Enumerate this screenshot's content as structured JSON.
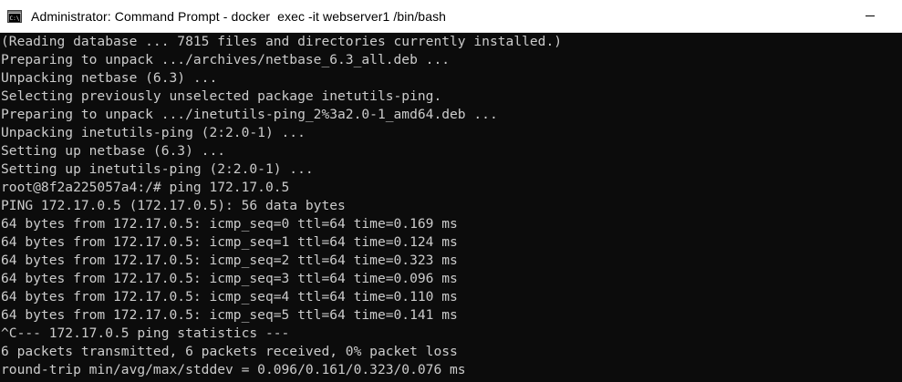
{
  "window": {
    "title": "Administrator: Command Prompt - docker  exec -it webserver1 /bin/bash",
    "icon": "command-prompt-icon",
    "minimize_icon": "minimize-icon"
  },
  "colors": {
    "titlebar_bg": "#ffffff",
    "terminal_bg": "#0c0c0c",
    "terminal_fg": "#cccccc"
  },
  "terminal": {
    "lines": [
      "(Reading database ... 7815 files and directories currently installed.)",
      "Preparing to unpack .../archives/netbase_6.3_all.deb ...",
      "Unpacking netbase (6.3) ...",
      "Selecting previously unselected package inetutils-ping.",
      "Preparing to unpack .../inetutils-ping_2%3a2.0-1_amd64.deb ...",
      "Unpacking inetutils-ping (2:2.0-1) ...",
      "Setting up netbase (6.3) ...",
      "Setting up inetutils-ping (2:2.0-1) ...",
      "root@8f2a225057a4:/# ping 172.17.0.5",
      "PING 172.17.0.5 (172.17.0.5): 56 data bytes",
      "64 bytes from 172.17.0.5: icmp_seq=0 ttl=64 time=0.169 ms",
      "64 bytes from 172.17.0.5: icmp_seq=1 ttl=64 time=0.124 ms",
      "64 bytes from 172.17.0.5: icmp_seq=2 ttl=64 time=0.323 ms",
      "64 bytes from 172.17.0.5: icmp_seq=3 ttl=64 time=0.096 ms",
      "64 bytes from 172.17.0.5: icmp_seq=4 ttl=64 time=0.110 ms",
      "64 bytes from 172.17.0.5: icmp_seq=5 ttl=64 time=0.141 ms",
      "^C--- 172.17.0.5 ping statistics ---",
      "6 packets transmitted, 6 packets received, 0% packet loss",
      "round-trip min/avg/max/stddev = 0.096/0.161/0.323/0.076 ms"
    ]
  }
}
